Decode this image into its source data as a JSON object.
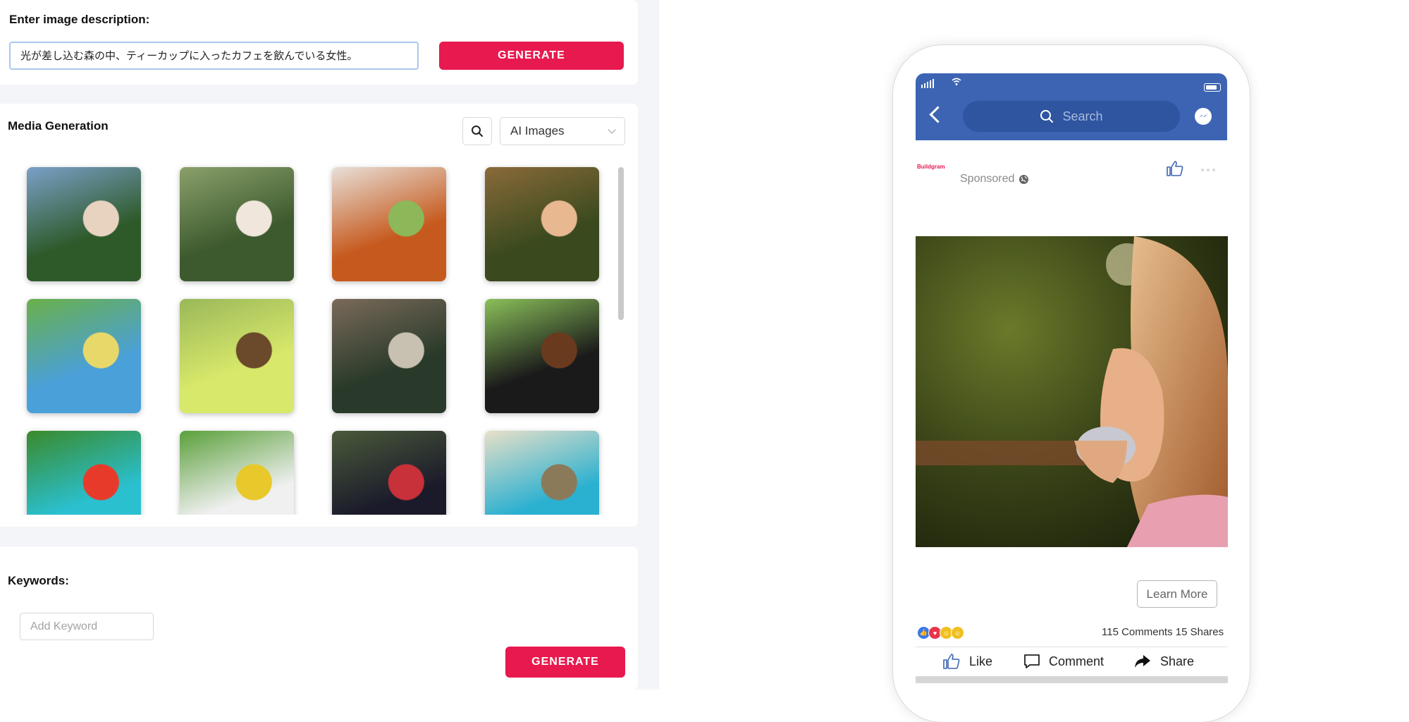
{
  "description_section": {
    "label": "Enter image description:",
    "input_value": "光が差し込む森の中、ティーカップに入ったカフェを飲んでいる女性。",
    "generate_label": "GENERATE"
  },
  "media_section": {
    "title": "Media Generation",
    "filter_selected": "AI Images",
    "thumbnails": [
      {
        "subject": "woman drinking tea, forest",
        "palette": [
          "#2e5a2a",
          "#7aa0c8",
          "#e8d2c0"
        ]
      },
      {
        "subject": "woman holding teacup in forest",
        "palette": [
          "#3d5a2e",
          "#8aa06a",
          "#f0e6dc"
        ]
      },
      {
        "subject": "woman at cafe table with flowers",
        "palette": [
          "#c65a1e",
          "#e8e0d8",
          "#8cb85a"
        ]
      },
      {
        "subject": "woman sipping from cup",
        "palette": [
          "#3a4a1e",
          "#8a6a3a",
          "#e8b890"
        ]
      },
      {
        "subject": "farmer with cabbages",
        "palette": [
          "#4aa0d8",
          "#6ab04a",
          "#e8d86a"
        ]
      },
      {
        "subject": "tiny farmer on cabbage",
        "palette": [
          "#d8e86a",
          "#9ab85a",
          "#6a4a2a"
        ]
      },
      {
        "subject": "farmer with crate of cabbages",
        "palette": [
          "#2a3a2a",
          "#7a6a5a",
          "#c8c0b0"
        ]
      },
      {
        "subject": "giant napa cabbage with farmer",
        "palette": [
          "#1a1a1a",
          "#8ac05a",
          "#6a3a1e"
        ]
      },
      {
        "subject": "farmer holding crate of vegetables",
        "palette": [
          "#2ac0d0",
          "#3a8a2a",
          "#e83a2a"
        ]
      },
      {
        "subject": "farmer with purple hat in field",
        "palette": [
          "#f0f0f0",
          "#5aa03a",
          "#e8c82a"
        ]
      },
      {
        "subject": "farmer at night with vegetables",
        "palette": [
          "#1a1a2a",
          "#4a5a3a",
          "#c8303a"
        ]
      },
      {
        "subject": "farmer under blue sky",
        "palette": [
          "#2ab0d0",
          "#e8e0c8",
          "#8a7a5a"
        ]
      }
    ]
  },
  "keywords_section": {
    "label": "Keywords:",
    "placeholder": "Add Keyword",
    "generate_label": "GENERATE"
  },
  "phone_preview": {
    "search_placeholder": "Search",
    "brand_logo_text": "Buildgram",
    "sponsored_label": "Sponsored",
    "learn_more_label": "Learn More",
    "stats_text": "115 Comments 15 Shares",
    "like_label": "Like",
    "comment_label": "Comment",
    "share_label": "Share",
    "colors": {
      "header": "#3c64b3",
      "accent": "#e8194f",
      "search_bg": "#2f55a0"
    }
  }
}
